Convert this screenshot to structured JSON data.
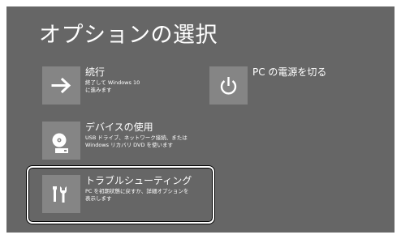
{
  "screen": {
    "title": "オプションの選択"
  },
  "options": {
    "continue": {
      "title": "続行",
      "description": "終了して Windows 10\nに進みます",
      "icon": "arrow-right-icon"
    },
    "use_device": {
      "title": "デバイスの使用",
      "description": "USB ドライブ、ネットワーク接続、または\nWindows リカバリ DVD を使います",
      "icon": "disc-drive-icon"
    },
    "troubleshoot": {
      "title": "トラブルシューティング",
      "description": "PC を初期状態に戻すか、詳細オプションを\n表示します",
      "icon": "tools-icon",
      "selected": true
    },
    "shutdown": {
      "title": "PC の電源を切る",
      "icon": "power-icon"
    }
  },
  "colors": {
    "background": "#666666",
    "tile": "#858585",
    "text": "#ffffff",
    "selection_border": "#ffffff"
  }
}
